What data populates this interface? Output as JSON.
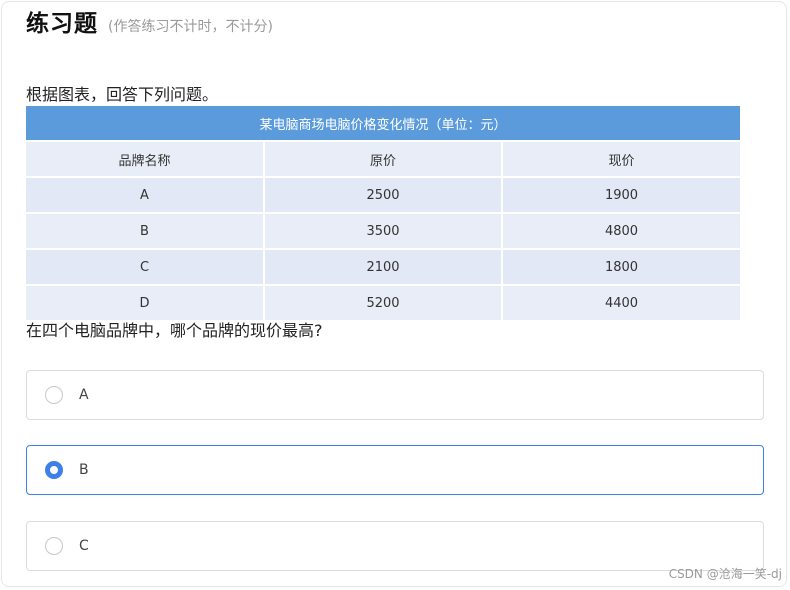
{
  "header": {
    "title": "练习题",
    "subtitle": "(作答练习不计时，不计分)"
  },
  "instruction": "根据图表，回答下列问题。",
  "table": {
    "caption": "某电脑商场电脑价格变化情况（单位：元）",
    "columns": [
      "品牌名称",
      "原价",
      "现价"
    ],
    "rows": [
      [
        "A",
        "2500",
        "1900"
      ],
      [
        "B",
        "3500",
        "4800"
      ],
      [
        "C",
        "2100",
        "1800"
      ],
      [
        "D",
        "5200",
        "4400"
      ]
    ]
  },
  "question": "在四个电脑品牌中，哪个品牌的现价最高?",
  "options": [
    {
      "label": "A",
      "selected": false
    },
    {
      "label": "B",
      "selected": true
    },
    {
      "label": "C",
      "selected": false
    }
  ],
  "watermark": "CSDN @沧海一笑-dj",
  "colors": {
    "table_header": "#5b9bdc",
    "accent": "#3f7fe8"
  }
}
